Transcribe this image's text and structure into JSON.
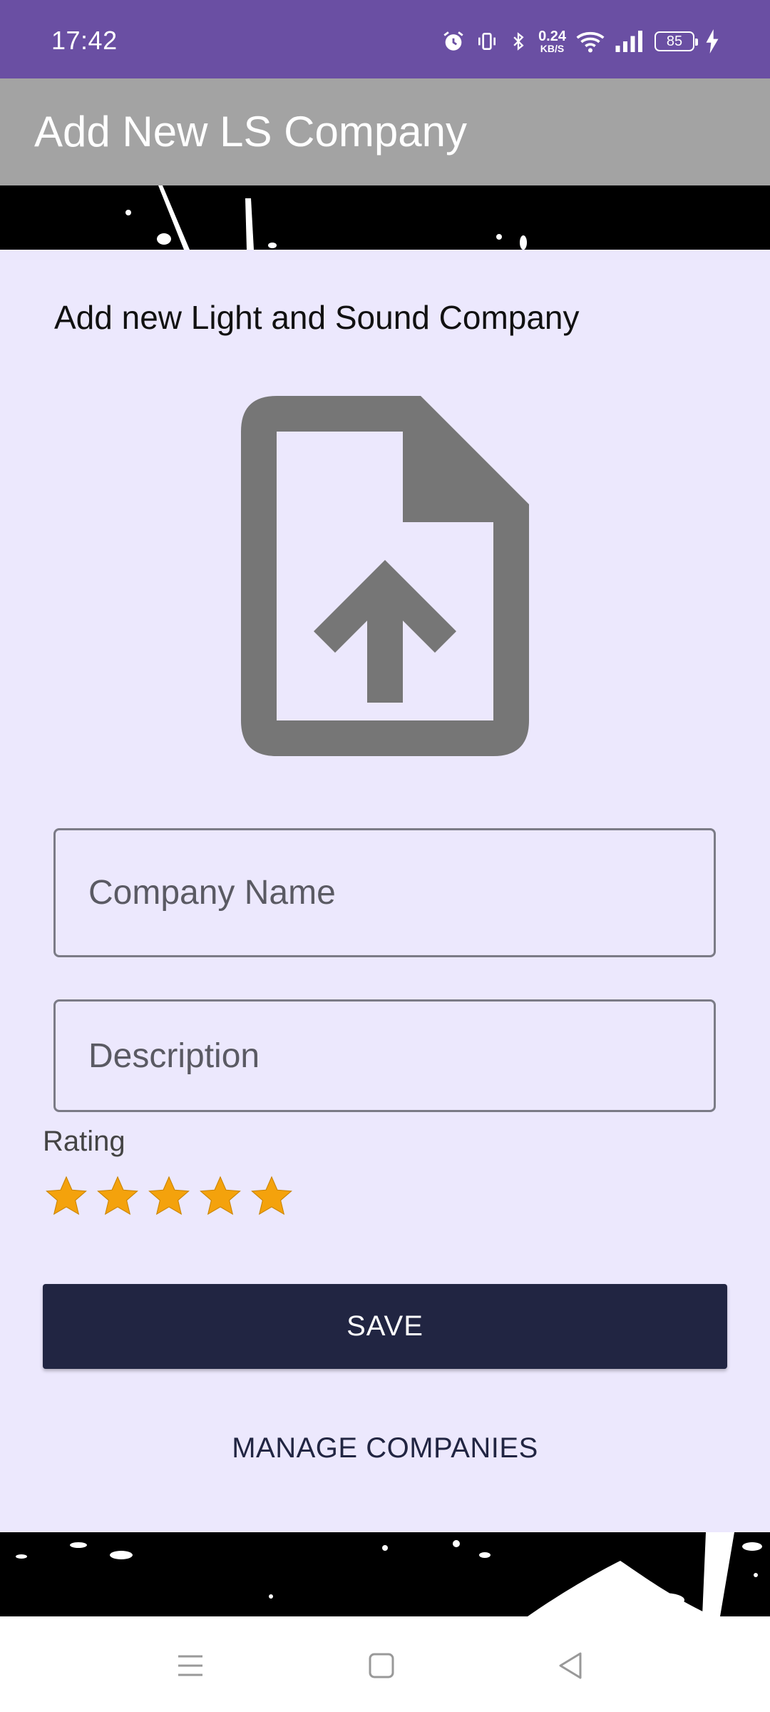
{
  "status_bar": {
    "time": "17:42",
    "net_speed_value": "0.24",
    "net_speed_unit": "KB/S",
    "battery": "85",
    "icons": [
      "alarm-icon",
      "vibrate-icon",
      "bluetooth-icon",
      "wifi-icon",
      "signal-icon",
      "battery-icon",
      "charging-icon"
    ]
  },
  "app_bar": {
    "title": "Add New LS Company"
  },
  "form": {
    "heading": "Add new Light and Sound Company",
    "upload_icon": "file-upload-icon",
    "company_name_placeholder": "Company Name",
    "company_name_value": "",
    "description_placeholder": "Description",
    "description_value": "",
    "rating_label": "Rating",
    "rating": 5,
    "rating_max": 5,
    "save_label": "SAVE",
    "manage_label": "MANAGE COMPANIES"
  },
  "nav_bar": {
    "icons": [
      "recents-icon",
      "home-icon",
      "back-icon"
    ]
  },
  "colors": {
    "status_bar": "#6a4fa3",
    "app_bar": "#a3a3a3",
    "content_bg": "#ece8fd",
    "button": "#212542",
    "star": "#f4a20c",
    "icon_gray": "#767676"
  }
}
